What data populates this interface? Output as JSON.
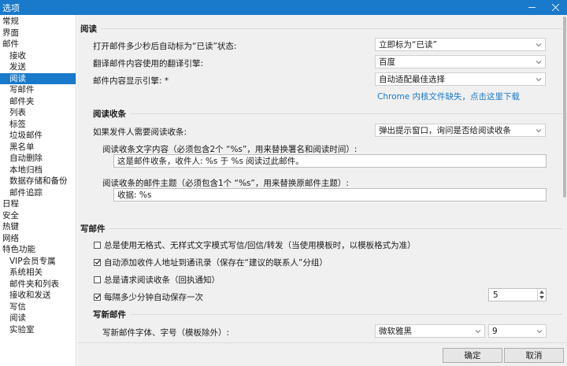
{
  "window": {
    "title": "选项"
  },
  "sidebar": {
    "items": [
      {
        "label": "常规",
        "level": 0
      },
      {
        "label": "界面",
        "level": 0
      },
      {
        "label": "邮件",
        "level": 0
      },
      {
        "label": "接收",
        "level": 1
      },
      {
        "label": "发送",
        "level": 1
      },
      {
        "label": "阅读",
        "level": 1,
        "active": true
      },
      {
        "label": "写邮件",
        "level": 1
      },
      {
        "label": "邮件夹",
        "level": 1
      },
      {
        "label": "列表",
        "level": 1
      },
      {
        "label": "标签",
        "level": 1
      },
      {
        "label": "垃圾邮件",
        "level": 1
      },
      {
        "label": "黑名单",
        "level": 1
      },
      {
        "label": "自动删除",
        "level": 1
      },
      {
        "label": "本地归档",
        "level": 1
      },
      {
        "label": "数据存储和备份",
        "level": 1
      },
      {
        "label": "邮件追踪",
        "level": 1
      },
      {
        "label": "日程",
        "level": 0
      },
      {
        "label": "安全",
        "level": 0
      },
      {
        "label": "热键",
        "level": 0
      },
      {
        "label": "网络",
        "level": 0
      },
      {
        "label": "特色功能",
        "level": 0
      },
      {
        "label": "VIP会员专属",
        "level": 1
      },
      {
        "label": "系统相关",
        "level": 1
      },
      {
        "label": "邮件夹和列表",
        "level": 1
      },
      {
        "label": "接收和发送",
        "level": 1
      },
      {
        "label": "写信",
        "level": 1
      },
      {
        "label": "阅读",
        "level": 1
      },
      {
        "label": "实验室",
        "level": 1
      }
    ]
  },
  "reading": {
    "title": "阅读",
    "mark_read_label": "打开邮件多少秒后自动标为“已读”状态:",
    "mark_read_value": "立即标为“已读”",
    "translate_label": "翻译邮件内容使用的翻译引擎:",
    "translate_value": "百度",
    "engine_label": "邮件内容显示引擎: *",
    "engine_value": "自动适配最佳选择",
    "chrome_link": "Chrome 内核文件缺失，点击这里下载"
  },
  "receipt": {
    "title": "阅读收条",
    "request_label": "如果发件人需要阅读收条:",
    "request_value": "弹出提示窗口，询问是否给阅读收条",
    "text_label": "阅读收条文字内容（必须包含2个 “%s”，用来替换署名和阅读时间）:",
    "text_value": "这是邮件收条，收件人: %s 于 %s 阅读过此邮件。",
    "subject_label": "阅读收条的邮件主题（必须包含1个 “%s”，用来替换原邮件主题）:",
    "subject_value": "收据: %s"
  },
  "compose": {
    "title": "写邮件",
    "options": [
      {
        "label": "总是使用无格式、无样式文字模式写信/回信/转发（当使用模板时，以模板格式为准）",
        "checked": false
      },
      {
        "label": "自动添加收件人地址到通讯录（保存在“建议的联系人”分组）",
        "checked": true
      },
      {
        "label": "总是请求阅读收条（回执通知）",
        "checked": false
      },
      {
        "label": "每隔多少分钟自动保存一次",
        "checked": true
      }
    ],
    "autosave_minutes": "5"
  },
  "new_mail": {
    "title": "写新邮件",
    "font_label": "写新邮件字体、字号（模板除外）:",
    "font_value": "微软雅黑",
    "size_value": "9"
  },
  "footer": {
    "ok": "确定",
    "cancel": "取消"
  }
}
